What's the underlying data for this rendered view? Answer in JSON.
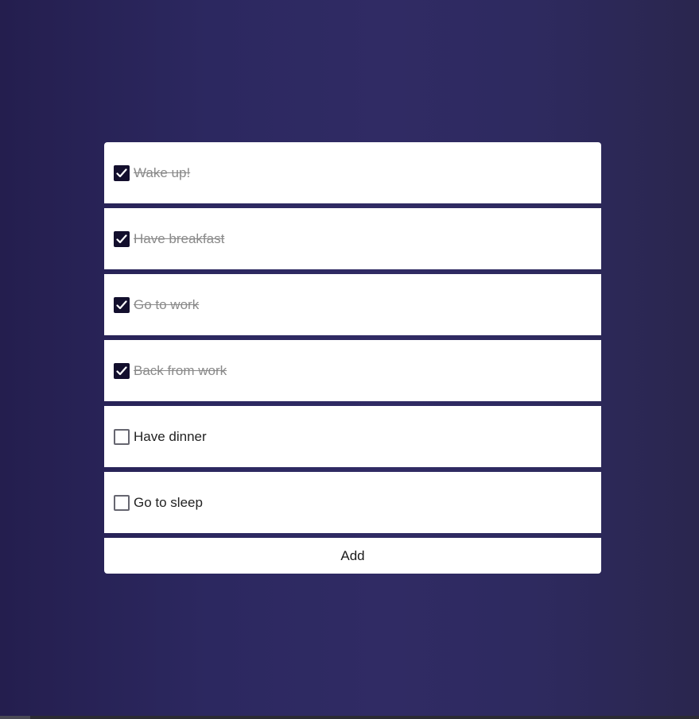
{
  "todos": [
    {
      "label": "Wake up!",
      "done": true,
      "icon": "check-icon"
    },
    {
      "label": "Have breakfast",
      "done": true,
      "icon": "check-icon"
    },
    {
      "label": "Go to work",
      "done": true,
      "icon": "check-icon"
    },
    {
      "label": "Back from work",
      "done": true,
      "icon": "check-icon"
    },
    {
      "label": "Have dinner",
      "done": false
    },
    {
      "label": "Go to sleep",
      "done": false
    }
  ],
  "add_button_label": "Add",
  "colors": {
    "checked_box": "#130f2d",
    "done_text": "#8a8a8a",
    "pending_text": "#222222",
    "card": "#ffffff"
  }
}
